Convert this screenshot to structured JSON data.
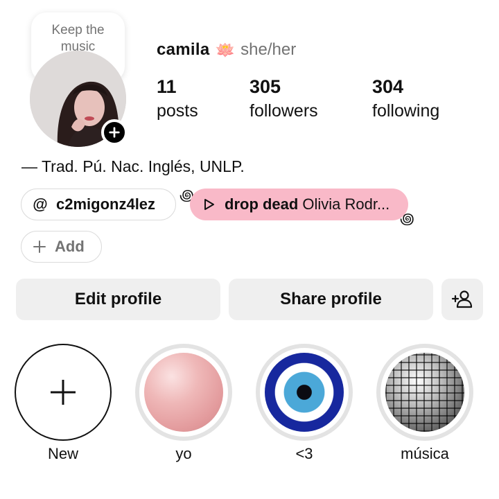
{
  "note": {
    "text": "Keep the music coming..."
  },
  "profile": {
    "name": "camila",
    "emoji": "🪷",
    "pronouns": "she/her",
    "bio": "— Trad. Pú. Nac. Inglés, UNLP."
  },
  "stats": [
    {
      "value": "11",
      "label": "posts"
    },
    {
      "value": "305",
      "label": "followers"
    },
    {
      "value": "304",
      "label": "following"
    }
  ],
  "links": {
    "threads_handle": "c2migonz4lez",
    "music_song": "drop dead",
    "music_artist": "Olivia Rodr...",
    "add_label": "Add"
  },
  "buttons": {
    "edit": "Edit profile",
    "share": "Share profile"
  },
  "highlights": [
    {
      "label": "New"
    },
    {
      "label": "yo"
    },
    {
      "label": "<3"
    },
    {
      "label": "música"
    }
  ],
  "colors": {
    "music_chip": "#f9b9c8",
    "button_bg": "#efefef",
    "secondary_text": "#737373"
  }
}
